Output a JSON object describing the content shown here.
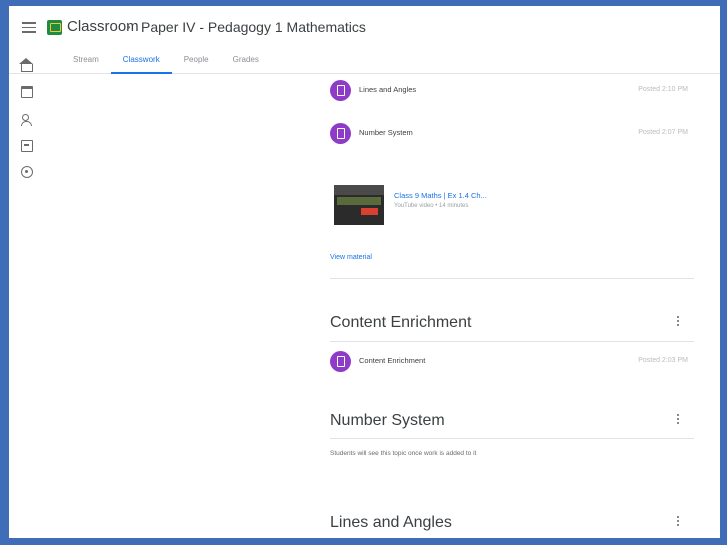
{
  "header": {
    "app_name": "Classroom",
    "separator": "›",
    "course_title": "Paper IV - Pedagogy 1 Mathematics"
  },
  "tabs": [
    {
      "label": "Stream",
      "active": false
    },
    {
      "label": "Classwork",
      "active": true
    },
    {
      "label": "People",
      "active": false
    },
    {
      "label": "Grades",
      "active": false
    }
  ],
  "rail": [
    "home-icon",
    "calendar-icon",
    "people-icon",
    "archive-icon",
    "settings-icon"
  ],
  "materials_top": [
    {
      "title": "Lines and Angles",
      "date": "Posted 2:10 PM"
    },
    {
      "title": "Number System",
      "date": "Posted 2:07 PM"
    }
  ],
  "attachment": {
    "title": "Class 9 Maths | Ex 1.4 Ch...",
    "subtitle": "YouTube video • 14 minutes"
  },
  "view_material": "View material",
  "topics": [
    {
      "title": "Content Enrichment",
      "items": [
        {
          "title": "Content Enrichment",
          "date": "Posted 2:03 PM"
        }
      ],
      "note": ""
    },
    {
      "title": "Number System",
      "items": [],
      "note": "Students will see this topic once work is added to it"
    },
    {
      "title": "Lines and Angles",
      "items": [],
      "note": ""
    }
  ],
  "colors": {
    "accent": "#1a73e8",
    "material_icon": "#8e3cc8",
    "logo": "#1e8e3e",
    "frame": "#3f6db8"
  }
}
